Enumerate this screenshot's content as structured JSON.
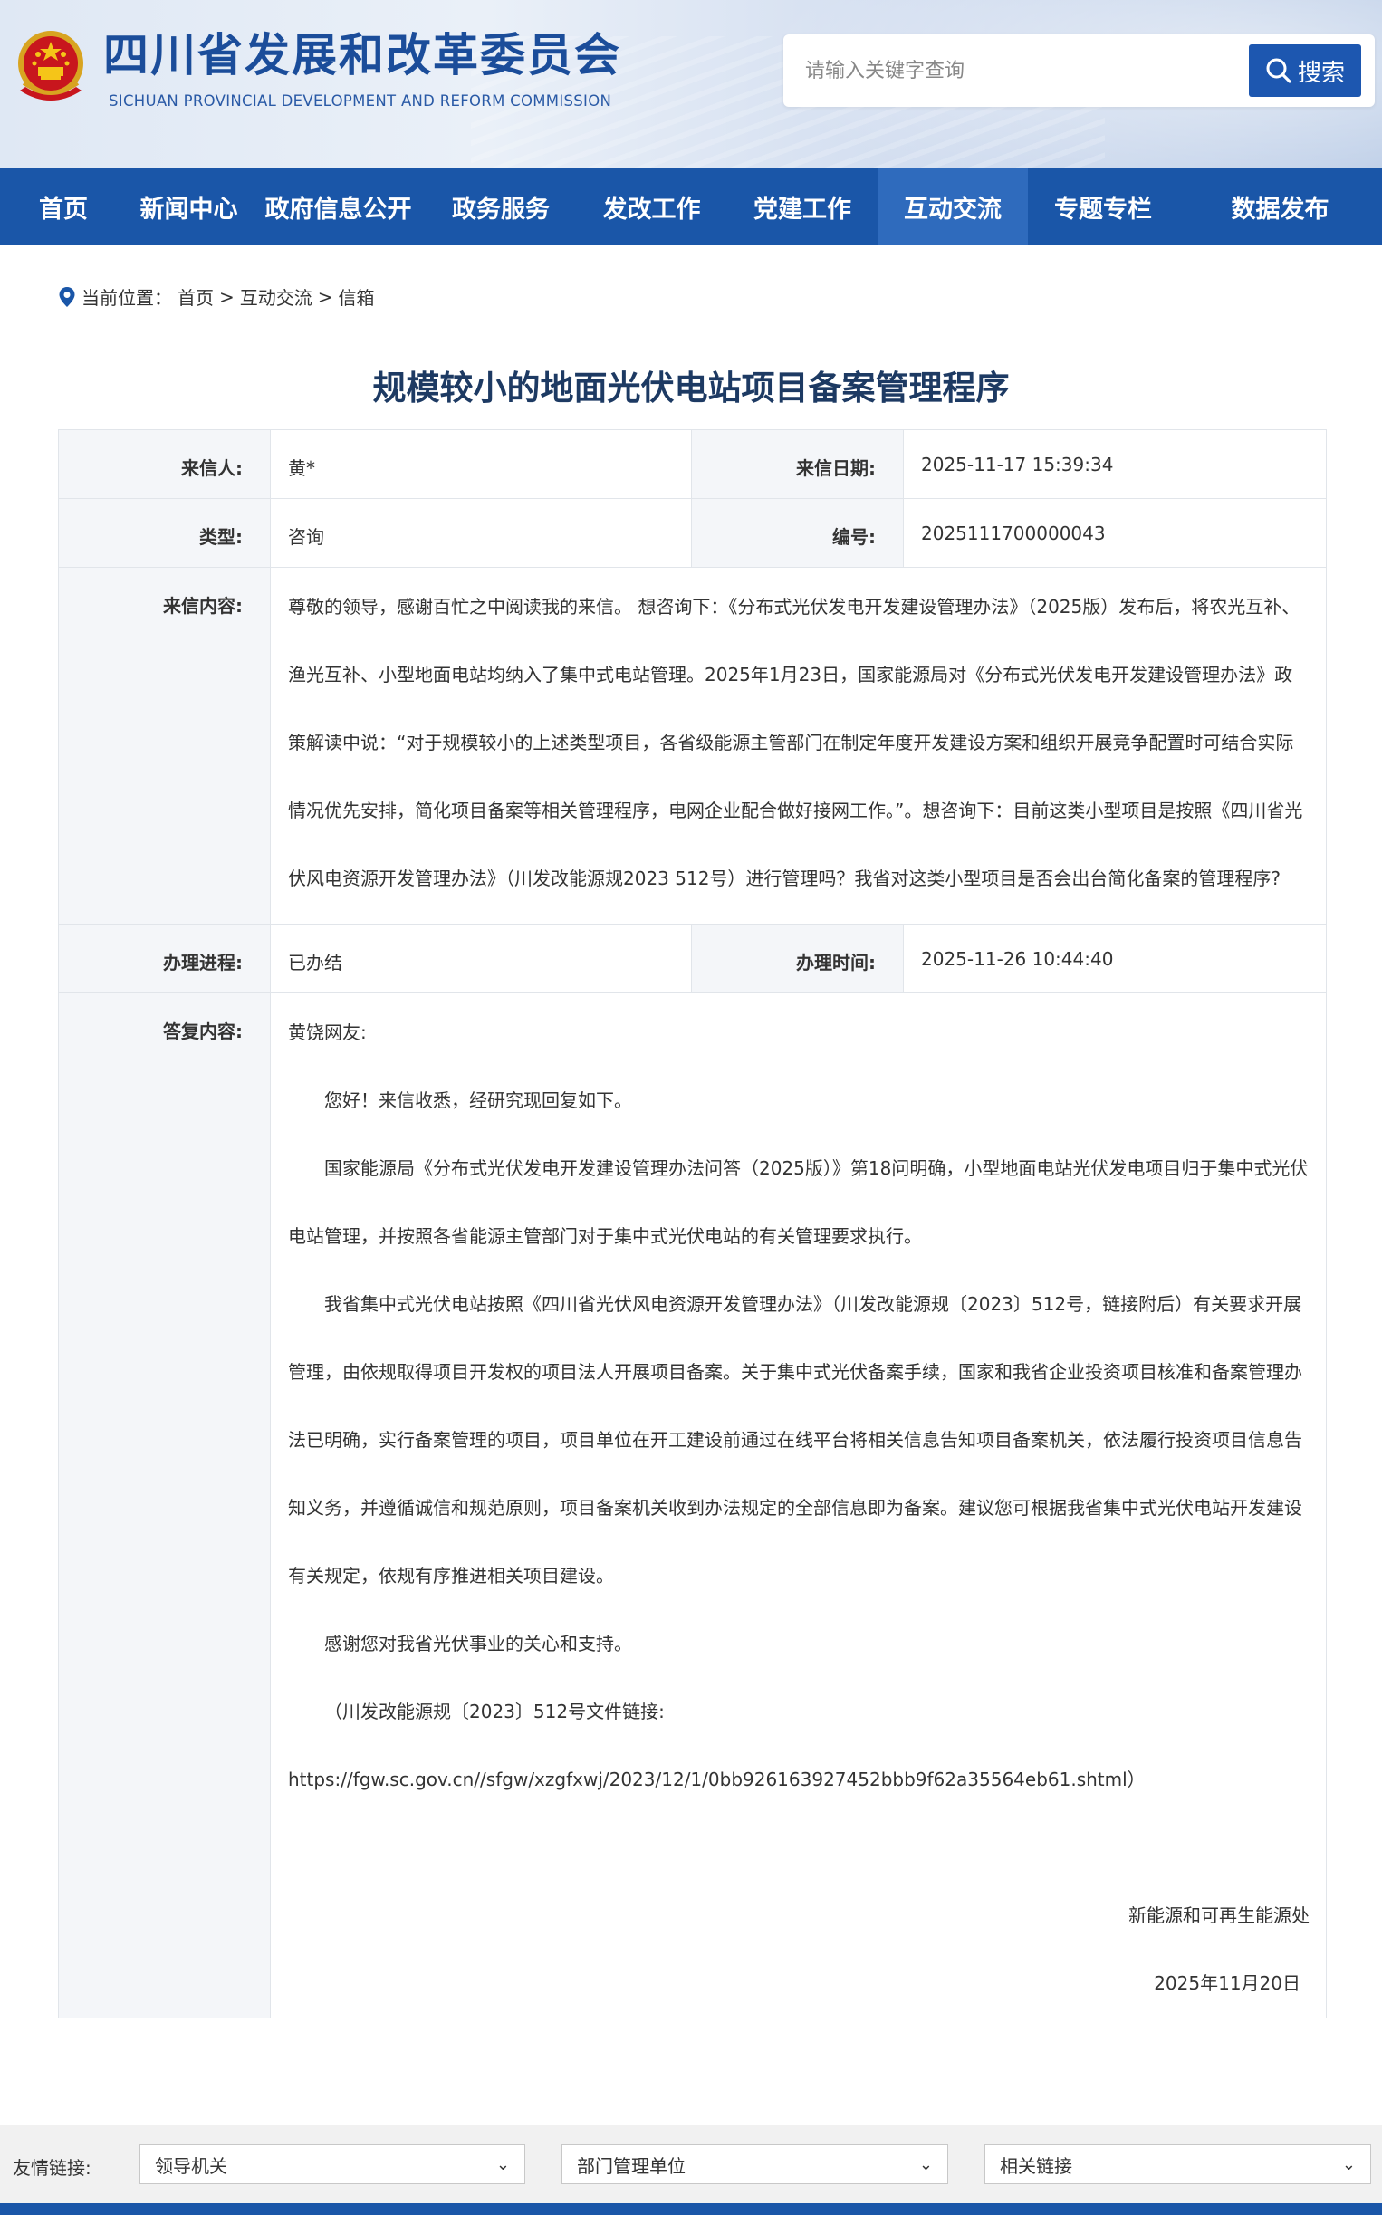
{
  "header": {
    "site_title": "四川省发展和改革委员会",
    "site_subtitle": "SICHUAN PROVINCIAL DEVELOPMENT AND REFORM COMMISSION",
    "search_placeholder": "请输入关键字查询",
    "search_button": "搜索"
  },
  "nav": {
    "items": [
      "首页",
      "新闻中心",
      "政府信息公开",
      "政务服务",
      "发改工作",
      "党建工作",
      "互动交流",
      "专题专栏",
      "数据发布"
    ],
    "active_index": 6
  },
  "breadcrumb": {
    "label": "当前位置：",
    "items": [
      "首页",
      "互动交流",
      "信箱"
    ],
    "separator": ">"
  },
  "title": "规模较小的地面光伏电站项目备案管理程序",
  "letter": {
    "sender_label": "来信人:",
    "sender": "黄*",
    "date_label": "来信日期:",
    "date": "2025-11-17 15:39:34",
    "type_label": "类型:",
    "type": "咨询",
    "number_label": "编号:",
    "number": "2025111700000043",
    "content_label": "来信内容:",
    "content": "尊敬的领导，感谢百忙之中阅读我的来信。 想咨询下：《分布式光伏发电开发建设管理办法》（2025版）发布后，将农光互补、渔光互补、小型地面电站均纳入了集中式电站管理。2025年1月23日，国家能源局对《分布式光伏发电开发建设管理办法》政策解读中说：“对于规模较小的上述类型项目，各省级能源主管部门在制定年度开发建设方案和组织开展竞争配置时可结合实际情况优先安排，简化项目备案等相关管理程序，电网企业配合做好接网工作。”。想咨询下：目前这类小型项目是按照《四川省光伏风电资源开发管理办法》（川发改能源规2023 512号）进行管理吗？我省对这类小型项目是否会出台简化备案的管理程序?",
    "progress_label": "办理进程:",
    "progress": "已办结",
    "handle_time_label": "办理时间:",
    "handle_time": "2025-11-26 10:44:40",
    "reply_label": "答复内容:",
    "reply": {
      "greeting": "黄饶网友:",
      "p1": "您好！来信收悉，经研究现回复如下。",
      "p2": "国家能源局《分布式光伏发电开发建设管理办法问答（2025版）》第18问明确，小型地面电站光伏发电项目归于集中式光伏电站管理，并按照各省能源主管部门对于集中式光伏电站的有关管理要求执行。",
      "p3": "我省集中式光伏电站按照《四川省光伏风电资源开发管理办法》（川发改能源规〔2023〕512号，链接附后）有关要求开展管理，由依规取得项目开发权的项目法人开展项目备案。关于集中式光伏备案手续，国家和我省企业投资项目核准和备案管理办法已明确，实行备案管理的项目，项目单位在开工建设前通过在线平台将相关信息告知项目备案机关，依法履行投资项目信息告知义务，并遵循诚信和规范原则，项目备案机关收到办法规定的全部信息即为备案。建议您可根据我省集中式光伏电站开发建设有关规定，依规有序推进相关项目建设。",
      "p4": "感谢您对我省光伏事业的关心和支持。",
      "p5": "（川发改能源规〔2023〕512号文件链接:",
      "link": "https://fgw.sc.gov.cn//sfgw/xzgfxwj/2023/12/1/0bb926163927452bbb9f62a35564eb61.shtml）",
      "signature": "新能源和可再生能源处",
      "date": "2025年11月20日"
    }
  },
  "footer": {
    "label": "友情链接:",
    "selects": [
      "领导机关",
      "部门管理单位",
      "相关链接"
    ]
  },
  "colors": {
    "nav_bg": "#1a56a8",
    "nav_active": "#2f6bbd",
    "title": "#1d3a63",
    "brand_blue": "#1b4d9a"
  }
}
